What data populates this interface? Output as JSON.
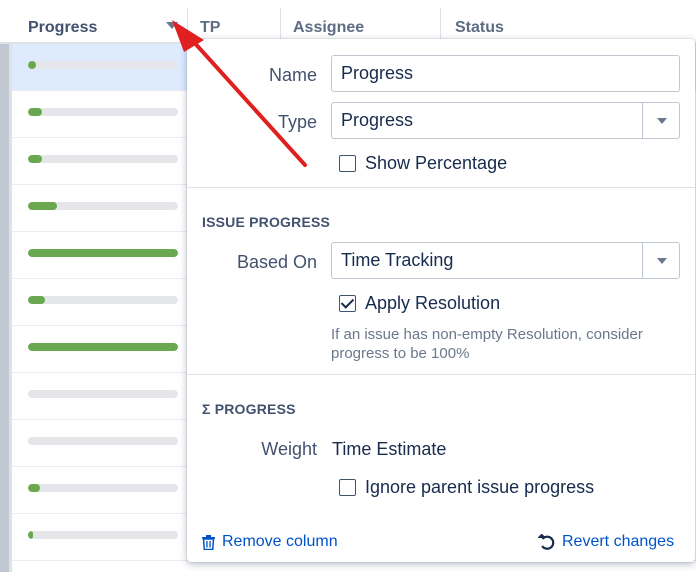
{
  "table": {
    "columns": [
      "Progress",
      "TP",
      "Assignee",
      "Status"
    ],
    "progress_rows": [
      0.05,
      0.09,
      0.09,
      0.19,
      1.0,
      0.11,
      1.0,
      0.0,
      0.0,
      0.08,
      0.03
    ],
    "progress_color": "#6aa84f"
  },
  "popup": {
    "name_label": "Name",
    "name_value": "Progress",
    "type_label": "Type",
    "type_value": "Progress",
    "show_percentage": "Show Percentage",
    "issue_progress_title": "ISSUE PROGRESS",
    "based_on_label": "Based On",
    "based_on_value": "Time Tracking",
    "apply_resolution": "Apply Resolution",
    "apply_resolution_help": "If an issue has non-empty Resolution, consider progress to be 100%",
    "sigma_progress_title": "Σ PROGRESS",
    "weight_label": "Weight",
    "weight_value": "Time Estimate",
    "ignore_parent": "Ignore parent issue progress",
    "remove_column": "Remove column",
    "revert_changes": "Revert changes"
  },
  "annotation": {
    "arrow_color": "#e02020"
  }
}
